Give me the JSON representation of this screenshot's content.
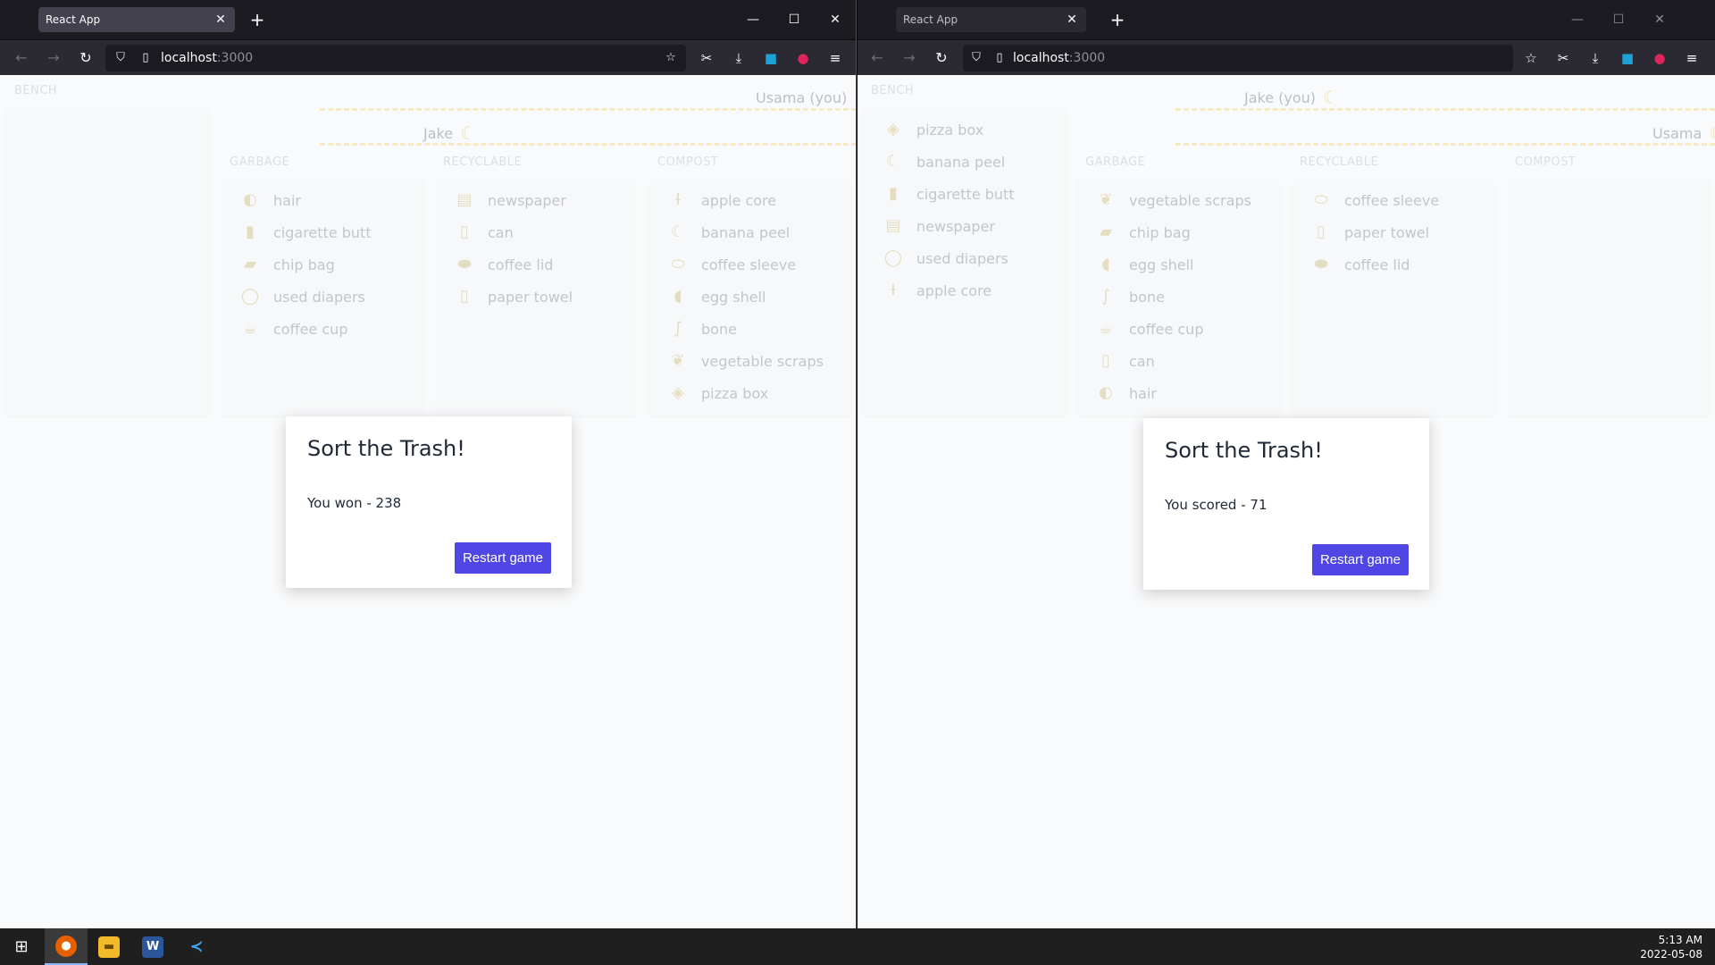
{
  "browser_left": {
    "tab_title": "React App",
    "url_host": "localhost",
    "url_port": ":3000",
    "players": {
      "top": "Usama (you)",
      "second": "Jake"
    },
    "sections": {
      "bench": "BENCH",
      "garbage": "GARBAGE",
      "recyclable": "RECYCLABLE",
      "compost": "COMPOST"
    },
    "bench_items": [],
    "garbage_items": [
      "hair",
      "cigarette butt",
      "chip bag",
      "used diapers",
      "coffee cup"
    ],
    "recyclable_items": [
      "newspaper",
      "can",
      "coffee lid",
      "paper towel"
    ],
    "compost_items": [
      "apple core",
      "banana peel",
      "coffee sleeve",
      "egg shell",
      "bone",
      "vegetable scraps",
      "pizza box"
    ],
    "modal": {
      "title": "Sort the Trash!",
      "message": "You won - 238",
      "button": "Restart game"
    }
  },
  "browser_right": {
    "tab_title": "React App",
    "url_host": "localhost",
    "url_port": ":3000",
    "players": {
      "top": "Jake (you)",
      "second": "Usama"
    },
    "sections": {
      "bench": "BENCH",
      "garbage": "GARBAGE",
      "recyclable": "RECYCLABLE",
      "compost": "COMPOST"
    },
    "bench_items": [
      "pizza box",
      "banana peel",
      "cigarette butt",
      "newspaper",
      "used diapers",
      "apple core"
    ],
    "garbage_items": [
      "vegetable scraps",
      "chip bag",
      "egg shell",
      "bone",
      "coffee cup",
      "can",
      "hair"
    ],
    "recyclable_items": [
      "coffee sleeve",
      "paper towel",
      "coffee lid"
    ],
    "compost_items": [],
    "modal": {
      "title": "Sort the Trash!",
      "message": "You scored - 71",
      "button": "Restart game"
    }
  },
  "taskbar": {
    "time": "5:13 AM",
    "date": "2022-05-08"
  },
  "colors": {
    "accent": "#4f46e5",
    "dash": "#f2c94c",
    "browser_chrome": "#1c1b22"
  }
}
